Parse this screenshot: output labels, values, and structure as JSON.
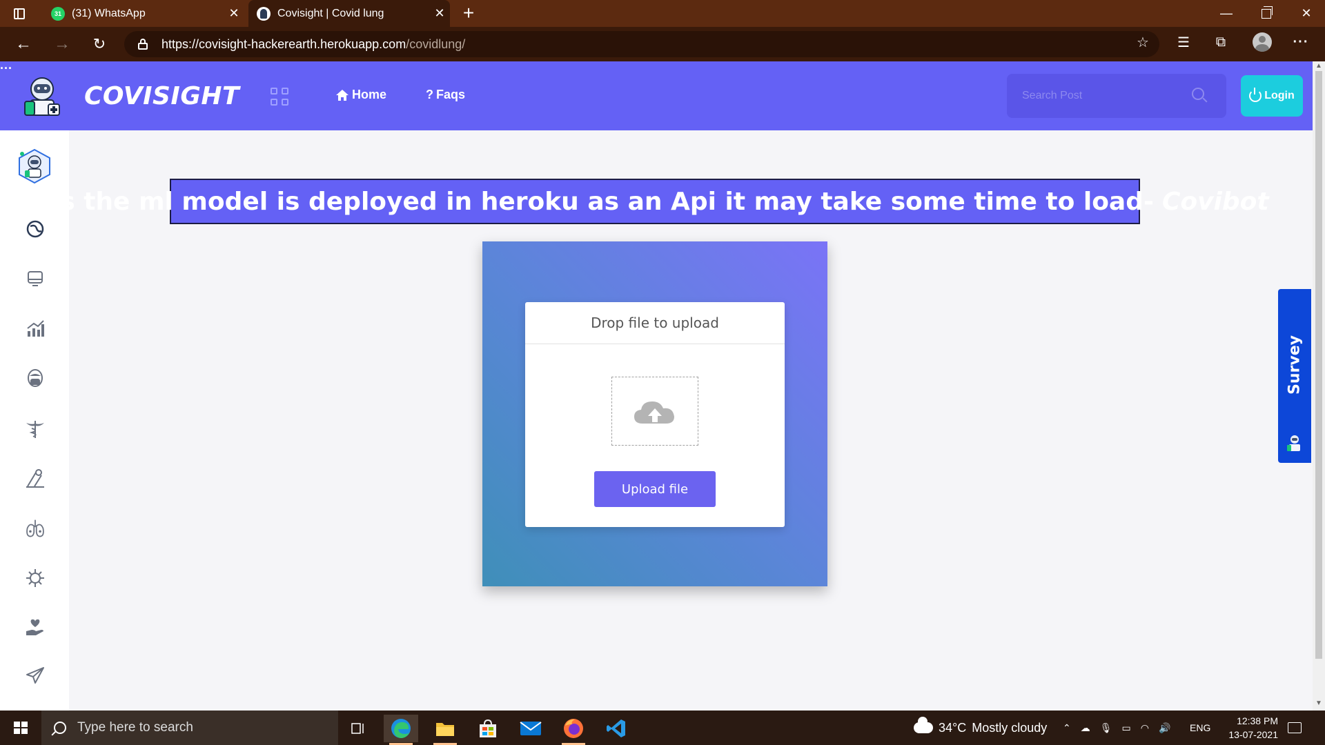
{
  "browser": {
    "tabs": [
      {
        "title": "(31) WhatsApp",
        "badge": "31",
        "icon": "whatsapp-icon"
      },
      {
        "title": "Covisight | Covid lung",
        "icon": "covisight-favicon"
      }
    ],
    "new_tab_label": "+",
    "url_host": "https://covisight-hackerearth.herokuapp.com",
    "url_path": "/covidlung/"
  },
  "header": {
    "brand": "COVISIGHT",
    "nav": [
      {
        "label": "Home",
        "icon": "home-icon"
      },
      {
        "label": "Faqs",
        "icon": "question-icon"
      }
    ],
    "more_label": "···",
    "search_placeholder": "Search Post",
    "login_label": "Login",
    "colors": {
      "primary": "#6461f5",
      "login": "#1ccdde"
    }
  },
  "sidebar": {
    "icons": [
      "globe-icon",
      "monitor-icon",
      "chart-icon",
      "mask-face-icon",
      "caduceus-icon",
      "lab-icon",
      "lungs-icon",
      "virus-icon",
      "care-hand-icon",
      "send-icon"
    ]
  },
  "main": {
    "notice_text": "As the ml model is deployed in heroku as an Api it may take some time to load-",
    "notice_author": "Covibot",
    "upload": {
      "title": "Drop file to upload",
      "button": "Upload file"
    }
  },
  "survey": {
    "label": "Survey"
  },
  "taskbar": {
    "search_placeholder": "Type here to search",
    "weather_temp": "34°C",
    "weather_desc": "Mostly cloudy",
    "lang": "ENG",
    "time": "12:38 PM",
    "date": "13-07-2021"
  }
}
